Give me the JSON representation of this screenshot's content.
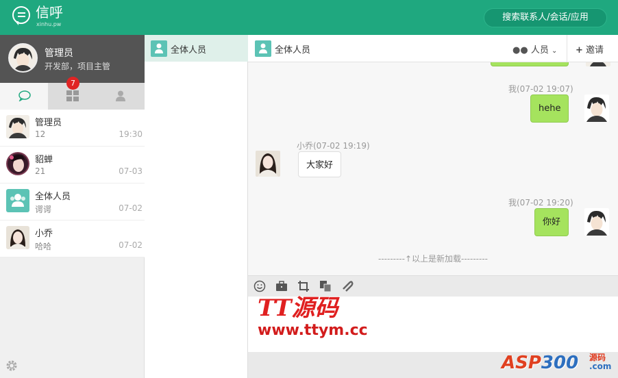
{
  "header": {
    "brand": "信呼",
    "brand_sub": "xinhu.pw",
    "search_label": "搜索联系人/会话/应用",
    "color": "#1fa87f"
  },
  "profile": {
    "name": "管理员",
    "dept": "开发部，项目主管"
  },
  "left_tabs": [
    {
      "icon": "chat-bubble-icon",
      "active": true
    },
    {
      "icon": "apps-grid-icon",
      "badge": "7"
    },
    {
      "icon": "user-icon"
    }
  ],
  "chats": [
    {
      "name": "管理员",
      "msg": "12",
      "time": "19:30",
      "avatar": "male-avatar"
    },
    {
      "name": "貂蝉",
      "msg": "21",
      "time": "07-03",
      "avatar": "female-avatar"
    },
    {
      "name": "全体人员",
      "msg": "谔谔",
      "time": "07-02",
      "avatar": "group-icon"
    },
    {
      "name": "小乔",
      "msg": "哈哈",
      "time": "07-02",
      "avatar": "female-avatar"
    }
  ],
  "mid": {
    "tab_label": "全体人员"
  },
  "conversation": {
    "title": "全体人员",
    "members_label": "人员",
    "invite_label": "邀请",
    "messages": [
      {
        "from": "me",
        "meta": "我(07-02 19:07)",
        "text": "hehe"
      },
      {
        "from": "other",
        "meta": "小乔(07-02 19:19)",
        "text": "大家好"
      },
      {
        "from": "me",
        "meta": "我(07-02 19:20)",
        "text": "你好"
      }
    ],
    "loaded_label": "---------↑以上是新加载---------"
  },
  "toolbar": [
    "emoji-icon",
    "briefcase-icon",
    "crop-icon",
    "copy-icon",
    "attach-icon"
  ],
  "watermarks": {
    "tt_logo": "TT源码",
    "tt_url": "www.ttym.cc",
    "asp_logo_a": "ASP",
    "asp_logo_b": "300",
    "asp_logo_c": "源码",
    "asp_logo_d": ".com"
  }
}
